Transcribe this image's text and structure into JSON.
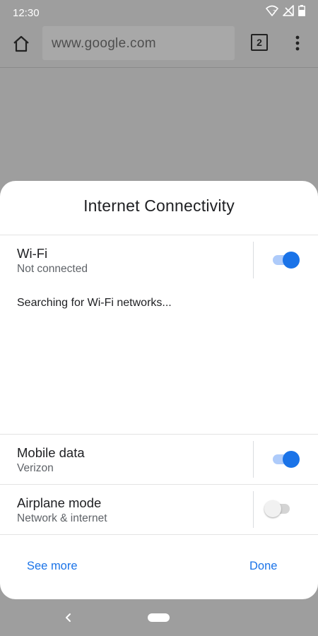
{
  "status_bar": {
    "time": "12:30",
    "icons": [
      "wifi-question-icon",
      "no-signal-icon",
      "battery-icon"
    ]
  },
  "browser": {
    "url": "www.google.com",
    "tab_count": "2",
    "icons": [
      "home-icon",
      "overflow-menu-icon"
    ]
  },
  "sheet": {
    "title": "Internet Connectivity",
    "wifi": {
      "label": "Wi-Fi",
      "status": "Not connected",
      "enabled": true
    },
    "searching_text": "Searching for Wi-Fi networks...",
    "mobile_data": {
      "label": "Mobile data",
      "carrier": "Verizon",
      "enabled": true
    },
    "airplane": {
      "label": "Airplane mode",
      "sub": "Network & internet",
      "enabled": false
    },
    "see_more_label": "See more",
    "done_label": "Done"
  },
  "nav_bar": {
    "icons": [
      "back-icon",
      "home-pill-icon"
    ]
  },
  "colors": {
    "accent": "#1a73e8",
    "scrim": "#9e9e9e"
  }
}
